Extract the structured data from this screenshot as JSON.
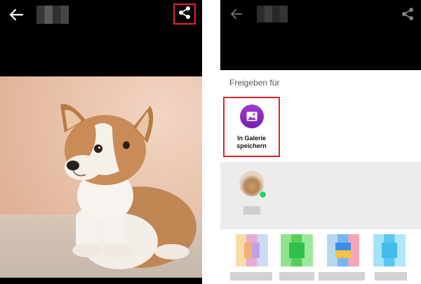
{
  "left": {
    "icons": {
      "back": "arrow-back-icon",
      "share": "share-icon"
    }
  },
  "right": {
    "icons": {
      "back": "arrow-back-icon",
      "share": "share-icon"
    },
    "share_sheet": {
      "title": "Freigeben für",
      "gallery_option": {
        "label_line1": "In Galerie",
        "label_line2": "speichern",
        "icon": "gallery-icon"
      }
    }
  },
  "colors": {
    "highlight": "#e2232b",
    "gallery_purple": "#8b2cc0",
    "whatsapp_green": "#25d366"
  }
}
